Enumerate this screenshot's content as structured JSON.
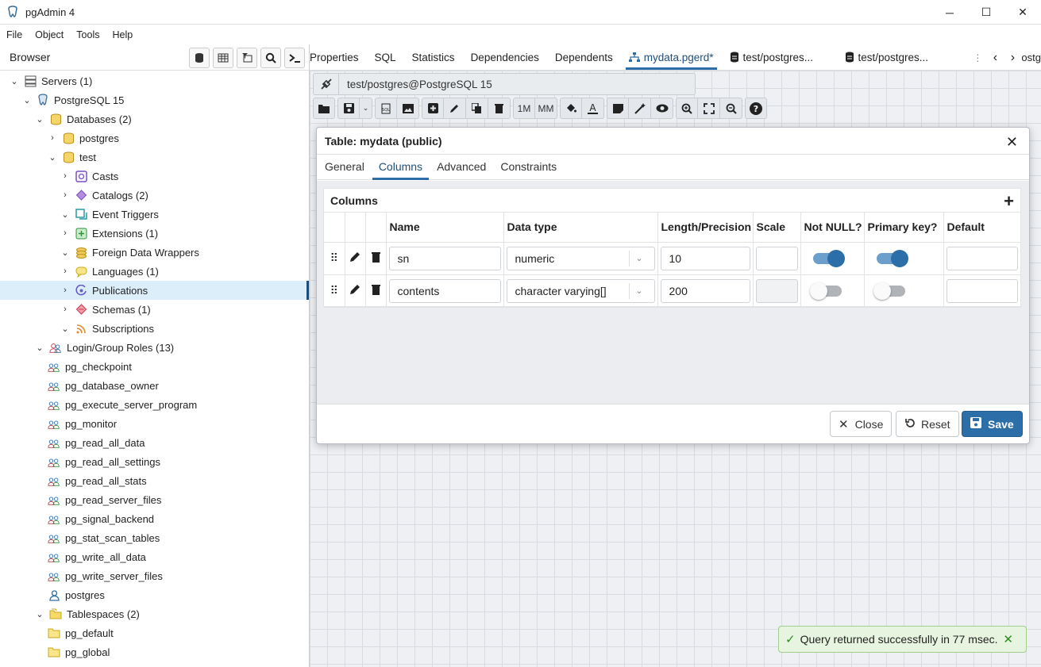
{
  "window": {
    "title": "pgAdmin 4",
    "minimize": "─",
    "maximize": "☐",
    "close": "✕"
  },
  "menu": [
    "File",
    "Object",
    "Tools",
    "Help"
  ],
  "browser": {
    "label": "Browser"
  },
  "tree": [
    {
      "label": "Servers (1)",
      "level": 0,
      "chev": "⌄",
      "icon": "servers-icon"
    },
    {
      "label": "PostgreSQL 15",
      "level": 1,
      "chev": "⌄",
      "icon": "elephant-icon"
    },
    {
      "label": "Databases (2)",
      "level": 2,
      "chev": "⌄",
      "icon": "databases-icon"
    },
    {
      "label": "postgres",
      "level": 3,
      "chev": "›",
      "icon": "database-icon"
    },
    {
      "label": "test",
      "level": 3,
      "chev": "⌄",
      "icon": "database-icon"
    },
    {
      "label": "Casts",
      "level": 4,
      "chev": "›",
      "icon": "casts-icon"
    },
    {
      "label": "Catalogs (2)",
      "level": 4,
      "chev": "›",
      "icon": "catalogs-icon"
    },
    {
      "label": "Event Triggers",
      "level": 4,
      "chev": "⌄",
      "icon": "event-triggers-icon"
    },
    {
      "label": "Extensions (1)",
      "level": 4,
      "chev": "›",
      "icon": "extensions-icon"
    },
    {
      "label": "Foreign Data Wrappers",
      "level": 4,
      "chev": "⌄",
      "icon": "fdw-icon"
    },
    {
      "label": "Languages (1)",
      "level": 4,
      "chev": "›",
      "icon": "languages-icon"
    },
    {
      "label": "Publications",
      "level": 4,
      "chev": "›",
      "icon": "publications-icon",
      "selected": true
    },
    {
      "label": "Schemas (1)",
      "level": 4,
      "chev": "›",
      "icon": "schemas-icon"
    },
    {
      "label": "Subscriptions",
      "level": 4,
      "chev": "⌄",
      "icon": "subscriptions-icon"
    },
    {
      "label": "Login/Group Roles (13)",
      "level": 2,
      "chev": "⌄",
      "icon": "roles-icon"
    },
    {
      "label": "pg_checkpoint",
      "level": 3,
      "chev": "",
      "icon": "role-icon"
    },
    {
      "label": "pg_database_owner",
      "level": 3,
      "chev": "",
      "icon": "role-icon"
    },
    {
      "label": "pg_execute_server_program",
      "level": 3,
      "chev": "",
      "icon": "role-icon"
    },
    {
      "label": "pg_monitor",
      "level": 3,
      "chev": "",
      "icon": "role-icon"
    },
    {
      "label": "pg_read_all_data",
      "level": 3,
      "chev": "",
      "icon": "role-icon"
    },
    {
      "label": "pg_read_all_settings",
      "level": 3,
      "chev": "",
      "icon": "role-icon"
    },
    {
      "label": "pg_read_all_stats",
      "level": 3,
      "chev": "",
      "icon": "role-icon"
    },
    {
      "label": "pg_read_server_files",
      "level": 3,
      "chev": "",
      "icon": "role-icon"
    },
    {
      "label": "pg_signal_backend",
      "level": 3,
      "chev": "",
      "icon": "role-icon"
    },
    {
      "label": "pg_stat_scan_tables",
      "level": 3,
      "chev": "",
      "icon": "role-icon"
    },
    {
      "label": "pg_write_all_data",
      "level": 3,
      "chev": "",
      "icon": "role-icon"
    },
    {
      "label": "pg_write_server_files",
      "level": 3,
      "chev": "",
      "icon": "role-icon"
    },
    {
      "label": "postgres",
      "level": 3,
      "chev": "",
      "icon": "user-icon"
    },
    {
      "label": "Tablespaces (2)",
      "level": 2,
      "chev": "⌄",
      "icon": "tablespaces-icon"
    },
    {
      "label": "pg_default",
      "level": 3,
      "chev": "",
      "icon": "folder-icon"
    },
    {
      "label": "pg_global",
      "level": 3,
      "chev": "",
      "icon": "folder-icon"
    }
  ],
  "tabs": [
    {
      "label": "Properties"
    },
    {
      "label": "SQL"
    },
    {
      "label": "Statistics"
    },
    {
      "label": "Dependencies"
    },
    {
      "label": "Dependents"
    },
    {
      "label": "mydata.pgerd*",
      "active": true,
      "icon": "erd-icon"
    },
    {
      "label": "test/postgres...",
      "icon": "query-tool-icon"
    },
    {
      "label": "test/postgres...",
      "icon": "query-tool-icon"
    }
  ],
  "tab_overflow": "ostg",
  "erd": {
    "connection": "test/postgres@PostgreSQL 15",
    "toolbar_text": {
      "one_to_many": "1M",
      "many_to_many": "MM"
    }
  },
  "dialog": {
    "title": "Table: mydata (public)",
    "tabs": [
      "General",
      "Columns",
      "Advanced",
      "Constraints"
    ],
    "active_tab": "Columns",
    "grid_title": "Columns",
    "headers": [
      "Name",
      "Data type",
      "Length/Precision",
      "Scale",
      "Not NULL?",
      "Primary key?",
      "Default"
    ],
    "rows": [
      {
        "name": "sn",
        "data_type": "numeric",
        "length": "10",
        "scale": "",
        "not_null": true,
        "primary_key": true,
        "default": ""
      },
      {
        "name": "contents",
        "data_type": "character varying[]",
        "length": "200",
        "scale": "",
        "not_null": false,
        "primary_key": false,
        "default": ""
      }
    ],
    "buttons": {
      "close": "Close",
      "reset": "Reset",
      "save": "Save"
    }
  },
  "toast": {
    "message": "Query returned successfully in 77 msec."
  },
  "colors": {
    "accent": "#2c6ea8",
    "selected_row": "#dbeefa",
    "toast_bg": "#e6f4e0"
  }
}
